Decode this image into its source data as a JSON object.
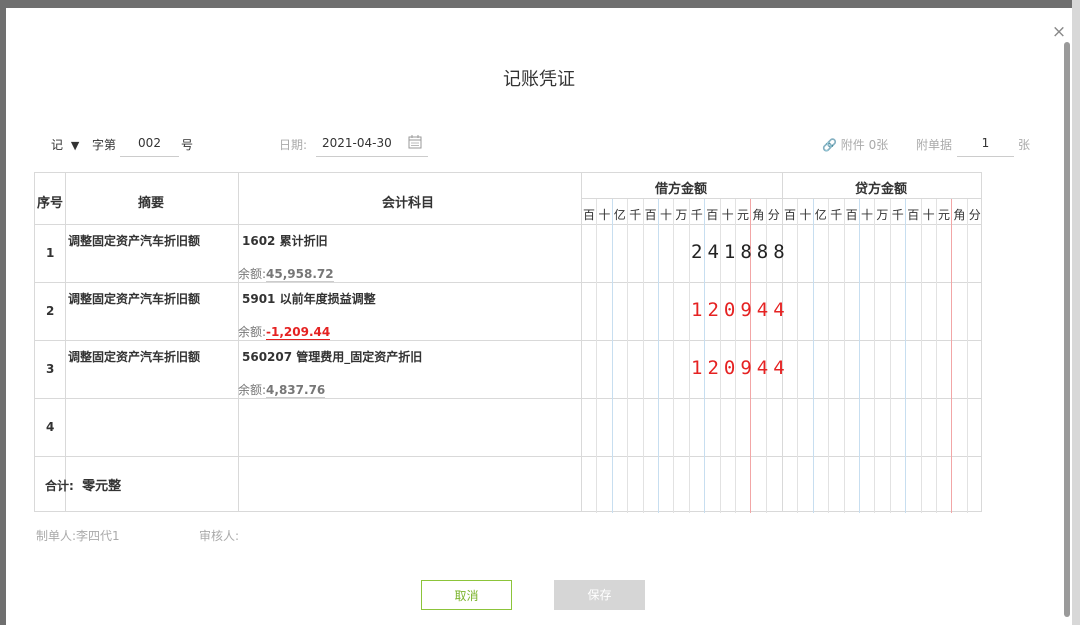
{
  "dialog": {
    "title": "记账凭证",
    "close_icon": "×"
  },
  "voucher_meta": {
    "word_value": "记",
    "word_suffix": "字第",
    "number": "002",
    "number_suffix": "号",
    "date_label": "日期:",
    "date_value": "2021-04-30",
    "attachment_link": "附件 0张",
    "attach_docs_label": "附单据",
    "attach_docs_count": "1",
    "attach_docs_unit": "张"
  },
  "table": {
    "headers": {
      "seq": "序号",
      "summary": "摘要",
      "account": "会计科目",
      "debit": "借方金额",
      "credit": "贷方金额"
    },
    "digit_units": [
      "百",
      "十",
      "亿",
      "千",
      "百",
      "十",
      "万",
      "千",
      "百",
      "十",
      "元",
      "角",
      "分"
    ],
    "rows": [
      {
        "seq": "1",
        "summary": "调整固定资产汽车折旧额",
        "account": "1602 累计折旧",
        "balance_label": "余额:",
        "balance": "45,958.72",
        "debit": "241888",
        "debit_color": "#222222",
        "credit": ""
      },
      {
        "seq": "2",
        "summary": "调整固定资产汽车折旧额",
        "account": "5901 以前年度损益调整",
        "balance_label": "余额:",
        "balance": "-1,209.44",
        "balance_color": "#e52222",
        "debit": "120944",
        "debit_color": "#e52222",
        "credit": ""
      },
      {
        "seq": "3",
        "summary": "调整固定资产汽车折旧额",
        "account": "560207 管理费用_固定资产折旧",
        "balance_label": "余额:",
        "balance": "4,837.76",
        "debit": "120944",
        "debit_color": "#e52222",
        "credit": ""
      },
      {
        "seq": "4",
        "summary": "",
        "account": "",
        "balance_label": "",
        "balance": "",
        "debit": "",
        "credit": ""
      }
    ],
    "total_label": "合计:",
    "total_words": "零元整"
  },
  "footer": {
    "maker_label": "制单人:",
    "maker": "李四代1",
    "reviewer_label": "审核人:",
    "reviewer": ""
  },
  "buttons": {
    "cancel": "取消",
    "save": "保存"
  },
  "colors": {
    "accent_green": "#7ab32b",
    "negative_red": "#e52222",
    "disabled_grey": "#d6d6d6"
  }
}
